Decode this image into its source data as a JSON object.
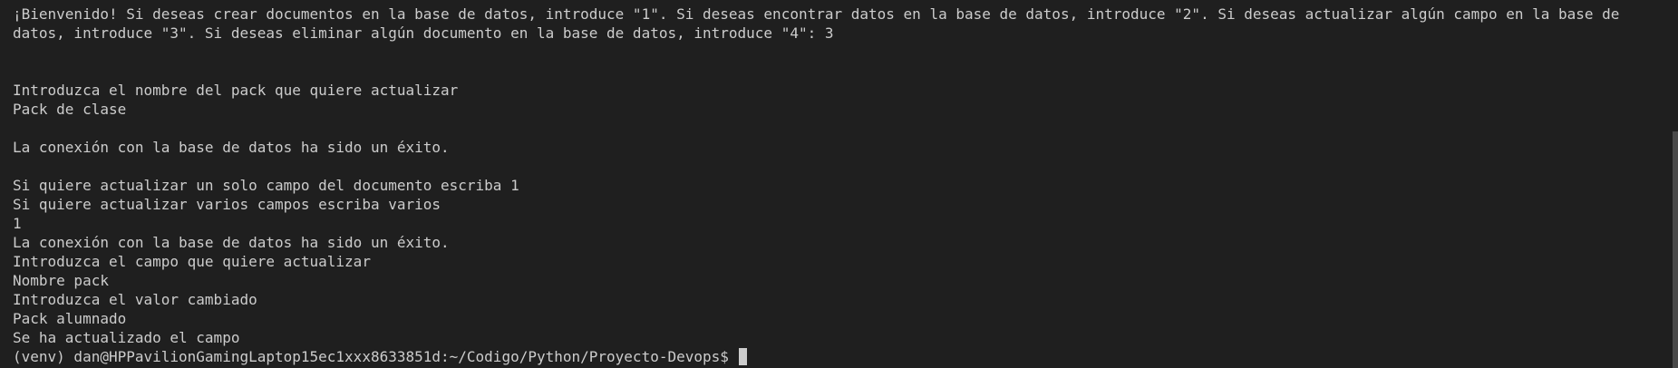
{
  "terminal": {
    "lines": [
      "¡Bienvenido! Si deseas crear documentos en la base de datos, introduce \"1\". Si deseas encontrar datos en la base de datos, introduce \"2\". Si deseas actualizar algún campo en la base de datos, introduce \"3\". Si deseas eliminar algún documento en la base de datos, introduce \"4\": 3",
      "",
      "",
      "Introduzca el nombre del pack que quiere actualizar",
      "Pack de clase",
      "",
      "La conexión con la base de datos ha sido un éxito.",
      "",
      "Si quiere actualizar un solo campo del documento escriba 1",
      "Si quiere actualizar varios campos escriba varios",
      "1",
      "La conexión con la base de datos ha sido un éxito.",
      "Introduzca el campo que quiere actualizar",
      "Nombre pack",
      "Introduzca el valor cambiado",
      "Pack alumnado",
      "Se ha actualizado el campo"
    ],
    "prompt": "(venv) dan@HPPavilionGamingLaptop15ec1xxx8633851d:~/Codigo/Python/Proyecto-Devops$ "
  }
}
